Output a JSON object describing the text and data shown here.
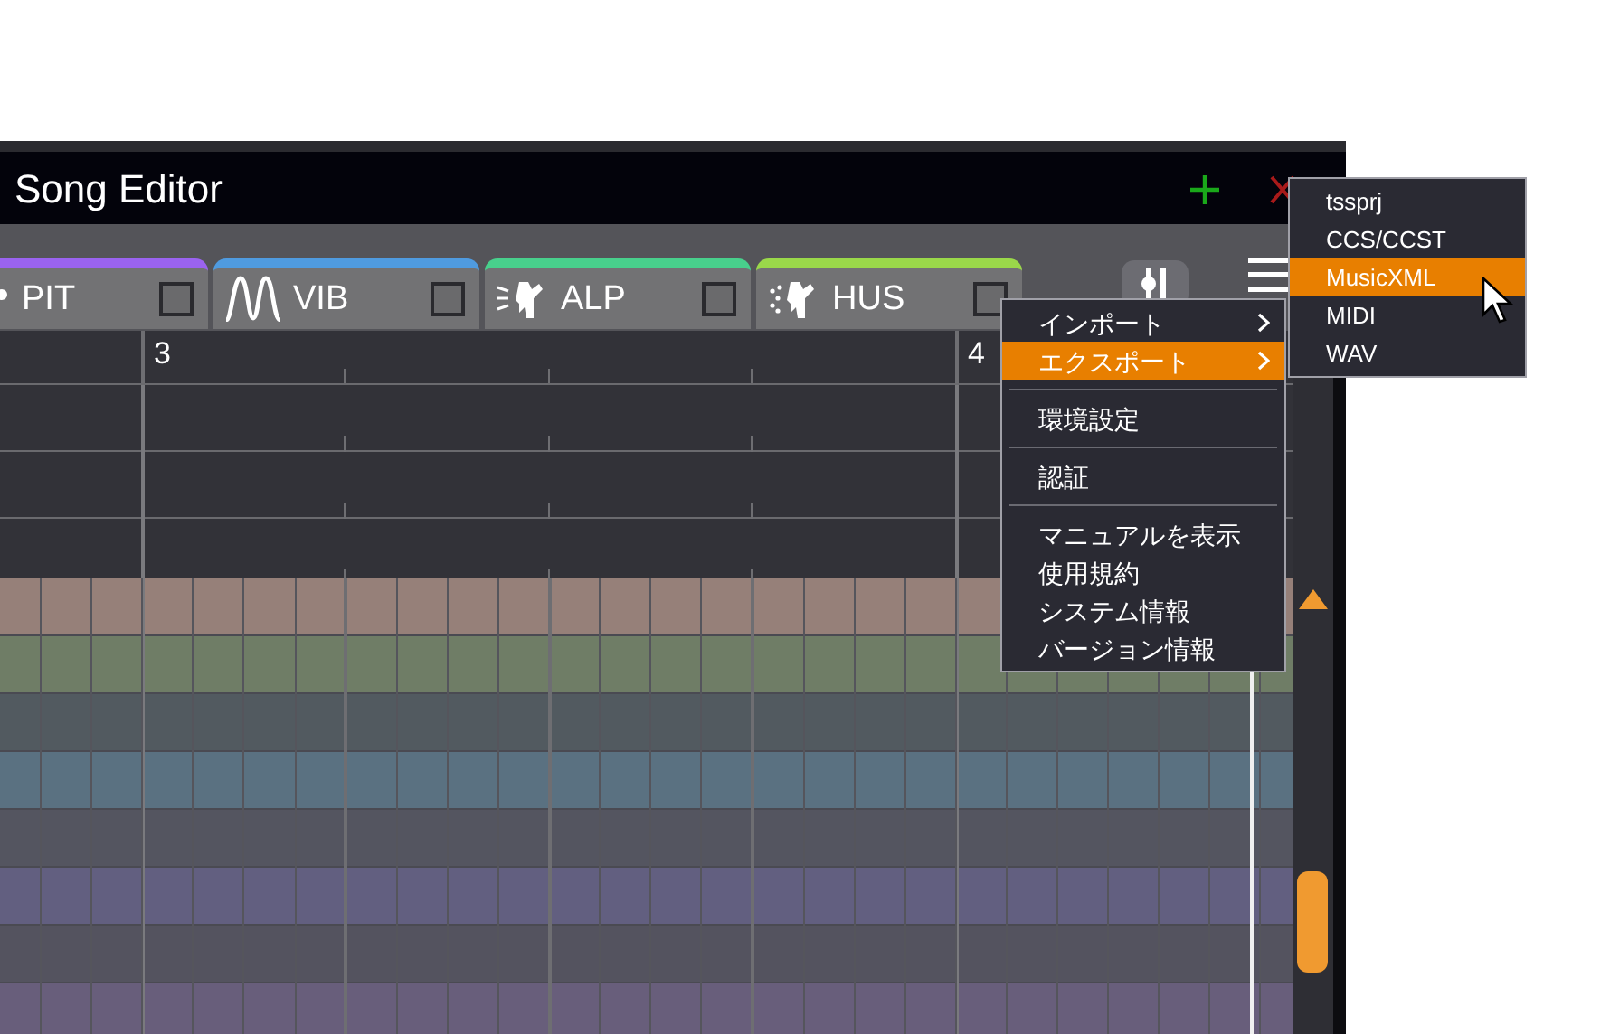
{
  "window": {
    "title": "Song Editor"
  },
  "tabs": [
    {
      "label": "PIT",
      "color": "#9a63f0",
      "checked": false
    },
    {
      "label": "VIB",
      "color": "#4f9be0",
      "checked": false
    },
    {
      "label": "ALP",
      "color": "#48d08c",
      "checked": false
    },
    {
      "label": "HUS",
      "color": "#9ad84a",
      "checked": false
    }
  ],
  "ruler": {
    "bars": [
      "3",
      "4"
    ]
  },
  "lanes": [
    {
      "color": "#968079"
    },
    {
      "color": "#6f7d66"
    },
    {
      "color": "#525a60"
    },
    {
      "color": "#5a7181"
    },
    {
      "color": "#545560"
    },
    {
      "color": "#625f80"
    },
    {
      "color": "#54535f"
    },
    {
      "color": "#685e7b"
    }
  ],
  "menu": {
    "items": [
      {
        "kind": "submenu",
        "label": "インポート",
        "selected": false
      },
      {
        "kind": "submenu",
        "label": "エクスポート",
        "selected": true
      },
      {
        "kind": "separator"
      },
      {
        "kind": "item",
        "label": "環境設定",
        "selected": false
      },
      {
        "kind": "separator"
      },
      {
        "kind": "item",
        "label": "認証",
        "selected": false
      },
      {
        "kind": "separator"
      },
      {
        "kind": "item",
        "label": "マニュアルを表示",
        "selected": false
      },
      {
        "kind": "item",
        "label": "使用規約",
        "selected": false
      },
      {
        "kind": "item",
        "label": "システム情報",
        "selected": false
      },
      {
        "kind": "item",
        "label": "バージョン情報",
        "selected": false
      }
    ]
  },
  "submenu": {
    "items": [
      {
        "label": "tssprj",
        "selected": false
      },
      {
        "label": "CCS/CCST",
        "selected": false
      },
      {
        "label": "MusicXML",
        "selected": true
      },
      {
        "label": "MIDI",
        "selected": false
      },
      {
        "label": "WAV",
        "selected": false
      }
    ]
  }
}
